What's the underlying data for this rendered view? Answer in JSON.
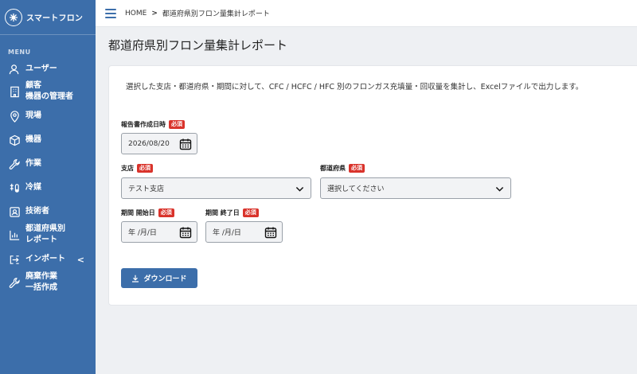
{
  "app": {
    "brand_name": "スマートフロン"
  },
  "sidebar": {
    "menu_heading": "MENU",
    "items": [
      {
        "icon": "user-icon",
        "label": "ユーザー"
      },
      {
        "icon": "building-icon",
        "label": "顧客\n機器の管理者"
      },
      {
        "icon": "location-pin-icon",
        "label": "現場"
      },
      {
        "icon": "box-icon",
        "label": "機器"
      },
      {
        "icon": "wrench-icon",
        "label": "作業"
      },
      {
        "icon": "refrigerant-icon",
        "label": "冷媒"
      },
      {
        "icon": "id-card-icon",
        "label": "技術者"
      },
      {
        "icon": "bar-chart-icon",
        "label": "都道府県別\nレポート"
      },
      {
        "icon": "import-icon",
        "label": "インポート",
        "caret": "<"
      },
      {
        "icon": "wrench-icon",
        "label": "廃棄作業\n一括作成"
      }
    ]
  },
  "breadcrumb": {
    "home": "HOME",
    "separator": ">",
    "current": "都道府県別フロン量集計レポート"
  },
  "page": {
    "title": "都道府県別フロン量集計レポート",
    "intro": "選択した支店・都道府県・期間に対して、CFC / HCFC / HFC 別のフロンガス充填量・回収量を集計し、Excelファイルで出力します。"
  },
  "form": {
    "required_badge": "必須",
    "report_date": {
      "label": "報告書作成日時",
      "value": "2026/08/20"
    },
    "branch": {
      "label": "支店",
      "value": "テスト支店"
    },
    "prefecture": {
      "label": "都道府県",
      "value": "選択してください"
    },
    "start_date": {
      "label": "期間 開始日",
      "placeholder": "年 /月/日"
    },
    "end_date": {
      "label": "期間 終了日",
      "placeholder": "年 /月/日"
    },
    "download_label": "ダウンロード"
  },
  "colors": {
    "sidebar": "#3c6eaa",
    "accent": "#3c6eaa",
    "required": "#d9332b"
  }
}
